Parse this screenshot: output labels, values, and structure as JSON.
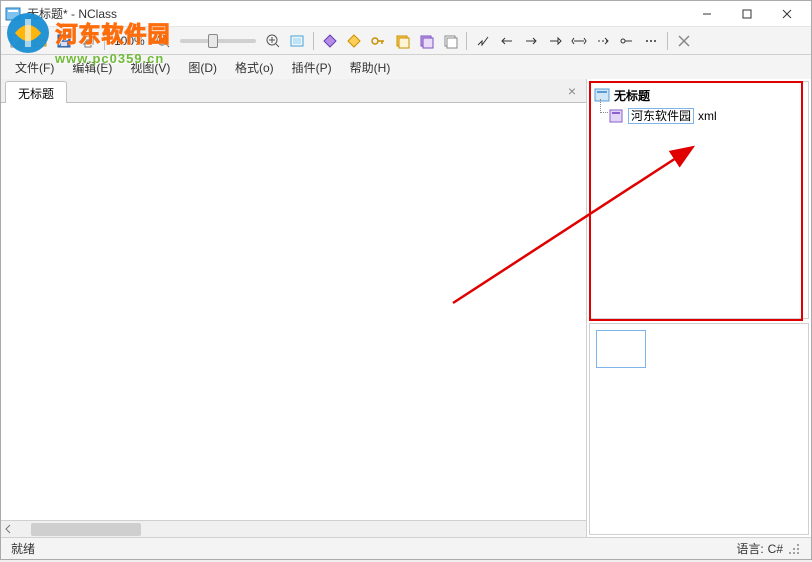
{
  "title": "无标题* - NClass",
  "zoom": "100%",
  "menu": {
    "file": "文件(F)",
    "edit": "编辑(E)",
    "view": "视图(V)",
    "diagram": "图(D)",
    "format": "格式(o)",
    "plugins": "插件(P)",
    "help": "帮助(H)"
  },
  "tab": "无标题",
  "tree": {
    "root": "无标题",
    "leaf": "河东软件园",
    "suffix": "xml"
  },
  "status": {
    "ready": "就绪",
    "lang_label": "语言:",
    "lang_value": "C#"
  },
  "watermark": {
    "text": "河东软件园",
    "url": "www.pc0359.cn"
  },
  "icons": {
    "new": "new-file-icon",
    "open": "open-folder-icon",
    "save": "save-icon",
    "print": "print-icon",
    "zoom_out": "zoom-out-icon",
    "zoom_in": "zoom-in-icon",
    "fit": "zoom-fit-icon",
    "d1": "diamond-icon",
    "d2": "diamond-gold-icon",
    "key": "key-icon",
    "db1": "stack-icon",
    "db2": "stack-purple-icon",
    "db3": "stack-white-icon",
    "a1": "arrow-icon",
    "a2": "arrow-left-icon",
    "a3": "arrow-right-icon",
    "a4": "arrow-open-icon",
    "a5": "arrow-double-icon",
    "a6": "arrow-dots-icon",
    "a7": "arrow-circle-icon",
    "a8": "arrow-more-icon",
    "close": "close-thin-icon"
  }
}
